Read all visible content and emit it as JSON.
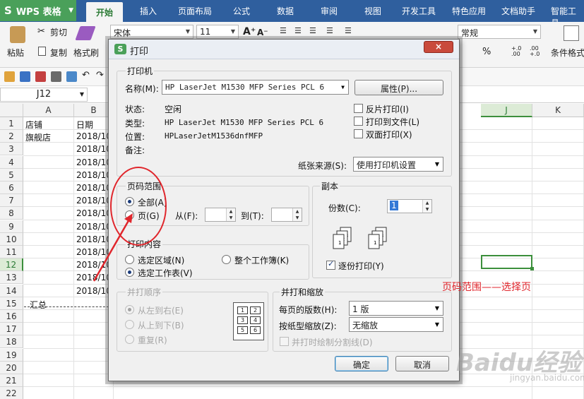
{
  "app": {
    "logo": "S",
    "name": "WPS 表格",
    "tabs": [
      "开始",
      "插入",
      "页面布局",
      "公式",
      "数据",
      "审阅",
      "视图",
      "开发工具",
      "特色应用",
      "文档助手",
      "智能工具"
    ]
  },
  "ribbon": {
    "paste": "粘贴",
    "cut": "剪切",
    "copy": "复制",
    "format_painter": "格式刷",
    "font_name": "宋体",
    "font_size": "11",
    "number_format": "常规",
    "percent": "%",
    "conditional_format": "条件格式"
  },
  "namebox": "J12",
  "sheet": {
    "columns": [
      "A",
      "B",
      "J",
      "K"
    ],
    "rows": [
      "1",
      "2",
      "3",
      "4",
      "5",
      "6",
      "7",
      "8",
      "9",
      "10",
      "11",
      "12",
      "13",
      "14",
      "15",
      "16",
      "17",
      "18",
      "19",
      "20",
      "21",
      "22"
    ],
    "header_a": "店铺",
    "header_b": "日期",
    "store": "旗舰店",
    "date_prefix": "2018/10",
    "total": "汇总"
  },
  "dialog": {
    "title": "打印",
    "close": "×",
    "printer": {
      "group": "打印机",
      "name_label": "名称(M):",
      "name_value": "HP LaserJet M1530 MFP Series PCL 6",
      "properties": "属性(P)...",
      "status_label": "状态:",
      "status_value": "空闲",
      "type_label": "类型:",
      "type_value": "HP LaserJet M1530 MFP Series PCL 6",
      "location_label": "位置:",
      "location_value": "HPLaserJetM1536dnfMFP",
      "comment_label": "备注:",
      "reverse_print": "反片打印(I)",
      "print_to_file": "打印到文件(L)",
      "duplex": "双面打印(X)",
      "paper_source_label": "纸张来源(S):",
      "paper_source_value": "使用打印机设置"
    },
    "page_range": {
      "group": "页码范围",
      "all": "全部(A)",
      "pages": "页(G)",
      "from": "从(F):",
      "to": "到(T):"
    },
    "copies": {
      "group": "副本",
      "count_label": "份数(C):",
      "count_value": "1",
      "collate": "逐份打印(Y)"
    },
    "print_content": {
      "group": "打印内容",
      "selection": "选定区域(N)",
      "workbook": "整个工作簿(K)",
      "sheet": "选定工作表(V)"
    },
    "merge_order": {
      "group": "并打顺序",
      "ltr": "从左到右(E)",
      "ttb": "从上到下(B)",
      "repeat": "重复(R)",
      "cells": [
        "1",
        "2",
        "3",
        "4",
        "5",
        "6"
      ]
    },
    "merge_scale": {
      "group": "并打和缩放",
      "pages_per_sheet_label": "每页的版数(H):",
      "pages_per_sheet_value": "1 版",
      "scale_label": "按纸型缩放(Z):",
      "scale_value": "无缩放",
      "divider": "并打时绘制分割线(D)"
    },
    "ok": "确定",
    "cancel": "取消"
  },
  "annotation": "页码范围——选择页",
  "watermark": "Baidu经验",
  "watermark_sub": "jingyan.baidu.com"
}
